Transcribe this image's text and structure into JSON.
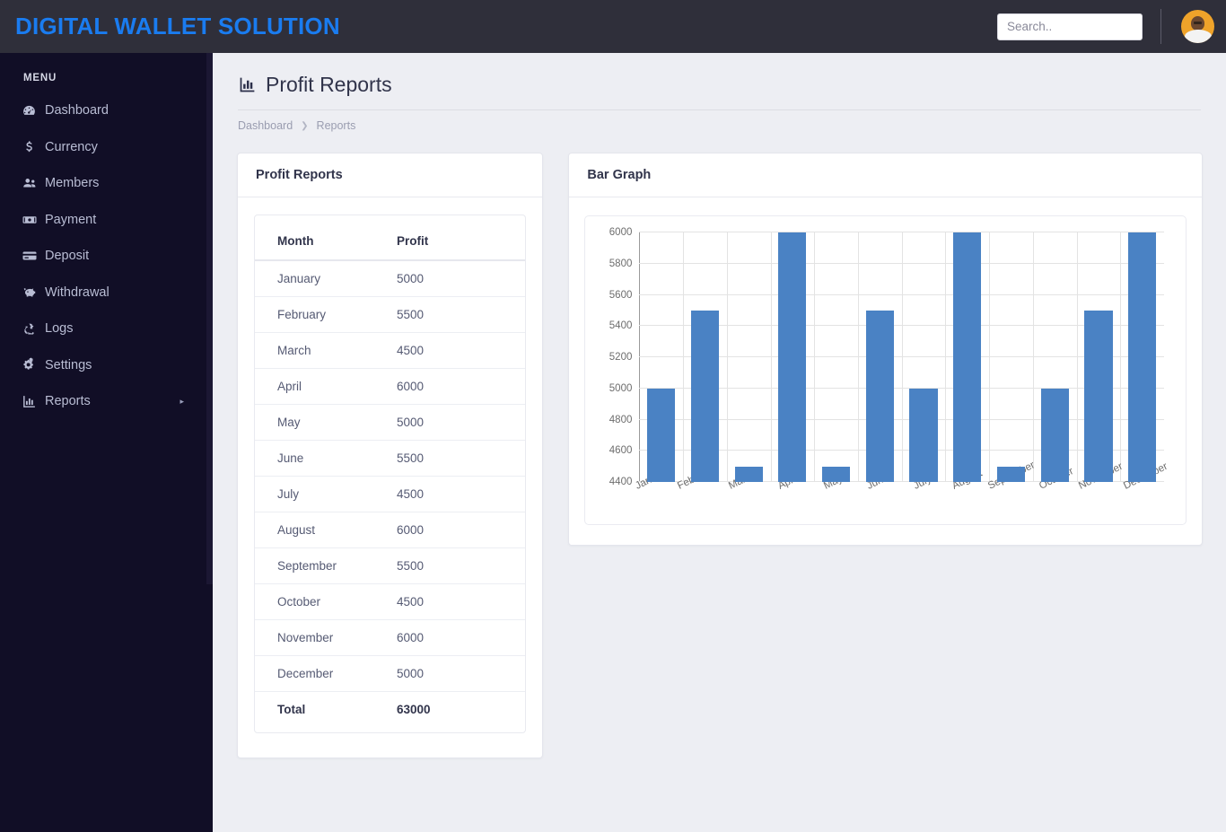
{
  "header": {
    "brand": "DIGITAL WALLET SOLUTION",
    "search_placeholder": "Search..",
    "search_value": ""
  },
  "sidebar": {
    "menu_label": "MENU",
    "items": [
      {
        "label": "Dashboard",
        "icon": "speedometer-icon",
        "caret": ""
      },
      {
        "label": "Currency",
        "icon": "dollar-icon",
        "caret": ""
      },
      {
        "label": "Members",
        "icon": "users-icon",
        "caret": ""
      },
      {
        "label": "Payment",
        "icon": "money-bill-icon",
        "caret": ""
      },
      {
        "label": "Deposit",
        "icon": "credit-card-icon",
        "caret": ""
      },
      {
        "label": "Withdrawal",
        "icon": "piggy-bank-icon",
        "caret": ""
      },
      {
        "label": "Logs",
        "icon": "recycle-icon",
        "caret": ""
      },
      {
        "label": "Settings",
        "icon": "gears-icon",
        "caret": ""
      },
      {
        "label": "Reports",
        "icon": "bar-chart-icon",
        "caret": "▸"
      }
    ]
  },
  "page": {
    "title": "Profit Reports",
    "title_icon": "bar-chart-icon",
    "breadcrumb": {
      "root": "Dashboard",
      "separator": "❯",
      "current": "Reports"
    }
  },
  "table_card": {
    "title": "Profit Reports",
    "columns": [
      "Month",
      "Profit"
    ],
    "rows": [
      [
        "January",
        "5000"
      ],
      [
        "February",
        "5500"
      ],
      [
        "March",
        "4500"
      ],
      [
        "April",
        "6000"
      ],
      [
        "May",
        "5000"
      ],
      [
        "June",
        "5500"
      ],
      [
        "July",
        "4500"
      ],
      [
        "August",
        "6000"
      ],
      [
        "September",
        "5500"
      ],
      [
        "October",
        "4500"
      ],
      [
        "November",
        "6000"
      ],
      [
        "December",
        "5000"
      ]
    ],
    "total_label": "Total",
    "total_value": "63000"
  },
  "chart_card": {
    "title": "Bar Graph"
  },
  "chart_data": {
    "type": "bar",
    "title": "Bar Graph",
    "categories": [
      "January",
      "February",
      "March",
      "April",
      "May",
      "June",
      "July",
      "August",
      "September",
      "October",
      "November",
      "December"
    ],
    "values": [
      5000,
      5500,
      4500,
      6000,
      4500,
      5500,
      5000,
      6000,
      4500,
      5000,
      5500,
      6000
    ],
    "yticks": [
      4400,
      4600,
      4800,
      5000,
      5200,
      5400,
      5600,
      5800,
      6000
    ],
    "ylim": [
      4400,
      6000
    ],
    "xlabel": "",
    "ylabel": "",
    "grid": true,
    "legend": false,
    "bar_color": "#4a82c4"
  },
  "colors": {
    "brand_blue": "#1a7cf0",
    "topbar_bg": "#2f2f3a",
    "sidebar_bg": "#110e26",
    "page_bg": "#edeef3",
    "bar_blue": "#4a82c4",
    "avatar_orange": "#efa32a"
  }
}
